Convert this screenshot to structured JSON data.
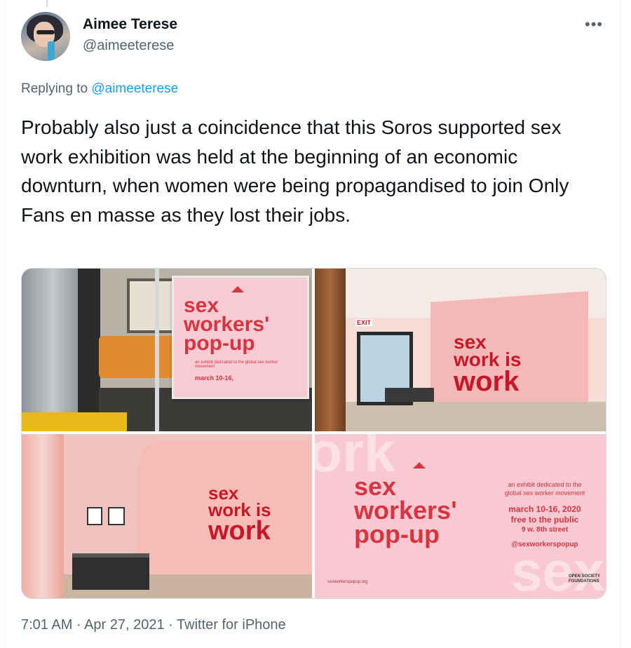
{
  "author": {
    "name": "Aimee Terese",
    "handle": "@aimeeterese"
  },
  "more_icon": "more-horizontal-icon",
  "reply": {
    "prefix": "Replying to",
    "to_handle": "@aimeeterese"
  },
  "tweet": {
    "text": "Probably also just a coincidence that this Soros supported sex work exhibition was held at the beginning of an economic downturn, when women were being propagandised to join Only Fans en masse as they lost their jobs."
  },
  "media": {
    "image1": {
      "poster_title": "sex workers' pop-up",
      "poster_sub": "an exhibit dedicated to the global sex worker movement",
      "poster_date": "march 10-16,"
    },
    "image2": {
      "wall_line1": "sex",
      "wall_line2": "work is",
      "wall_line3": "work",
      "exit_sign": "EXIT"
    },
    "image3": {
      "wall_line1": "sex",
      "wall_line2": "work is",
      "wall_line3": "work"
    },
    "image4": {
      "logo_line1": "sex",
      "logo_line2": "workers'",
      "logo_line3": "pop-up",
      "sub1": "an exhibit dedicated to the",
      "sub2": "global sex worker movement",
      "date": "march 10-16, 2020",
      "free": "free to the public",
      "address": "9 w. 8th street",
      "social": "@sexworkerspopup",
      "url": "sexworkerspopup.org",
      "sponsor": "OPEN SOCIETY FOUNDATIONS"
    }
  },
  "footer": {
    "time": "7:01 AM",
    "sep1": "·",
    "date": "Apr 27, 2021",
    "sep2": "·",
    "source": "Twitter for iPhone"
  },
  "colors": {
    "link": "#1d9bf0",
    "muted": "#536471",
    "poster_red": "#d8343f"
  }
}
